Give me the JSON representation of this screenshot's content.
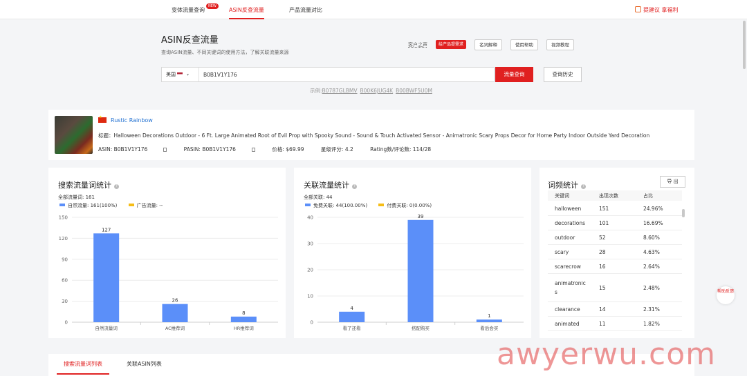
{
  "topnav": {
    "tabs": [
      {
        "label": "变体流量查询",
        "badge": "NEW"
      },
      {
        "label": "ASIN反查流量",
        "active": true
      },
      {
        "label": "产品流量对比"
      }
    ],
    "feedback": "提建议 拿福利"
  },
  "header": {
    "title": "ASIN反查流量",
    "subtitle": "查询ASIN流量、不同关键词的使用方法，了解关联流量来源",
    "customer_voice": "客户之声",
    "product_request": "给产品提需求",
    "buttons": [
      "名词解释",
      "使用帮助",
      "视频教程"
    ]
  },
  "search": {
    "country": "美国",
    "value": "B0B1V1Y176",
    "submit": "流量查询",
    "history": "查询历史",
    "example_label": "示例:",
    "examples": [
      "B0787GLBMV",
      "B00K6JUG4K",
      "B00BWF5U0M"
    ]
  },
  "product": {
    "brand": "Rustic Rainbow",
    "title": "标题：Halloween Decorations Outdoor - 6 Ft. Large Animated Root of Evil Prop with Spooky Sound - Sound & Touch Activated Sensor - Animatronic Scary Props Decor for Home Party Indoor Outside Yard Decoration",
    "asin": "ASIN: B0B1V1Y176",
    "pasin": "PASIN: B0B1V1Y176",
    "price": "价格: $69.99",
    "star": "星级评分: 4.2",
    "rating": "Rating数/评论数: 114/28"
  },
  "search_traffic": {
    "title": "搜索流量词统计",
    "total": "全部流量词: 161",
    "legend": [
      {
        "label": "自然流量: 161(100%)",
        "color": "#5b8ff9"
      },
      {
        "label": "广告流量: --",
        "color": "#f6bd16"
      }
    ]
  },
  "related_traffic": {
    "title": "关联流量统计",
    "total": "全部关联: 44",
    "legend": [
      {
        "label": "免费关联: 44(100.00%)",
        "color": "#5b8ff9"
      },
      {
        "label": "付费关联: 0(0.00%)",
        "color": "#f6bd16"
      }
    ]
  },
  "word_freq": {
    "title": "词频统计",
    "export": "导 出",
    "headers": [
      "关键词",
      "出现次数",
      "占比"
    ],
    "rows": [
      {
        "word": "halloween",
        "count": "151",
        "pct": "24.96%"
      },
      {
        "word": "decorations",
        "count": "101",
        "pct": "16.69%"
      },
      {
        "word": "outdoor",
        "count": "52",
        "pct": "8.60%"
      },
      {
        "word": "scary",
        "count": "28",
        "pct": "4.63%"
      },
      {
        "word": "scarecrow",
        "count": "16",
        "pct": "2.64%"
      },
      {
        "word": "animatronic\ns",
        "count": "15",
        "pct": "2.48%"
      },
      {
        "word": "clearance",
        "count": "14",
        "pct": "2.31%"
      },
      {
        "word": "animated",
        "count": "11",
        "pct": "1.82%"
      }
    ]
  },
  "help_float": "帮助反馈",
  "bottom_tabs": [
    "搜索流量词列表",
    "关联ASIN列表"
  ],
  "watermark": "awyerwu.com",
  "chart_data": [
    {
      "type": "bar",
      "categories": [
        "自然流量词",
        "AC推荐词",
        "HR推荐词"
      ],
      "values": [
        127,
        26,
        8
      ],
      "ylim": [
        0,
        150
      ],
      "yticks": [
        0,
        30,
        60,
        90,
        120,
        150
      ],
      "color": "#5b8ff9",
      "grid": true
    },
    {
      "type": "bar",
      "categories": [
        "看了还看",
        "搭配购买",
        "看后会买"
      ],
      "values": [
        4,
        39,
        1
      ],
      "ylim": [
        0,
        40
      ],
      "yticks": [
        0,
        10,
        20,
        30,
        40
      ],
      "color": "#5b8ff9",
      "grid": true
    }
  ]
}
